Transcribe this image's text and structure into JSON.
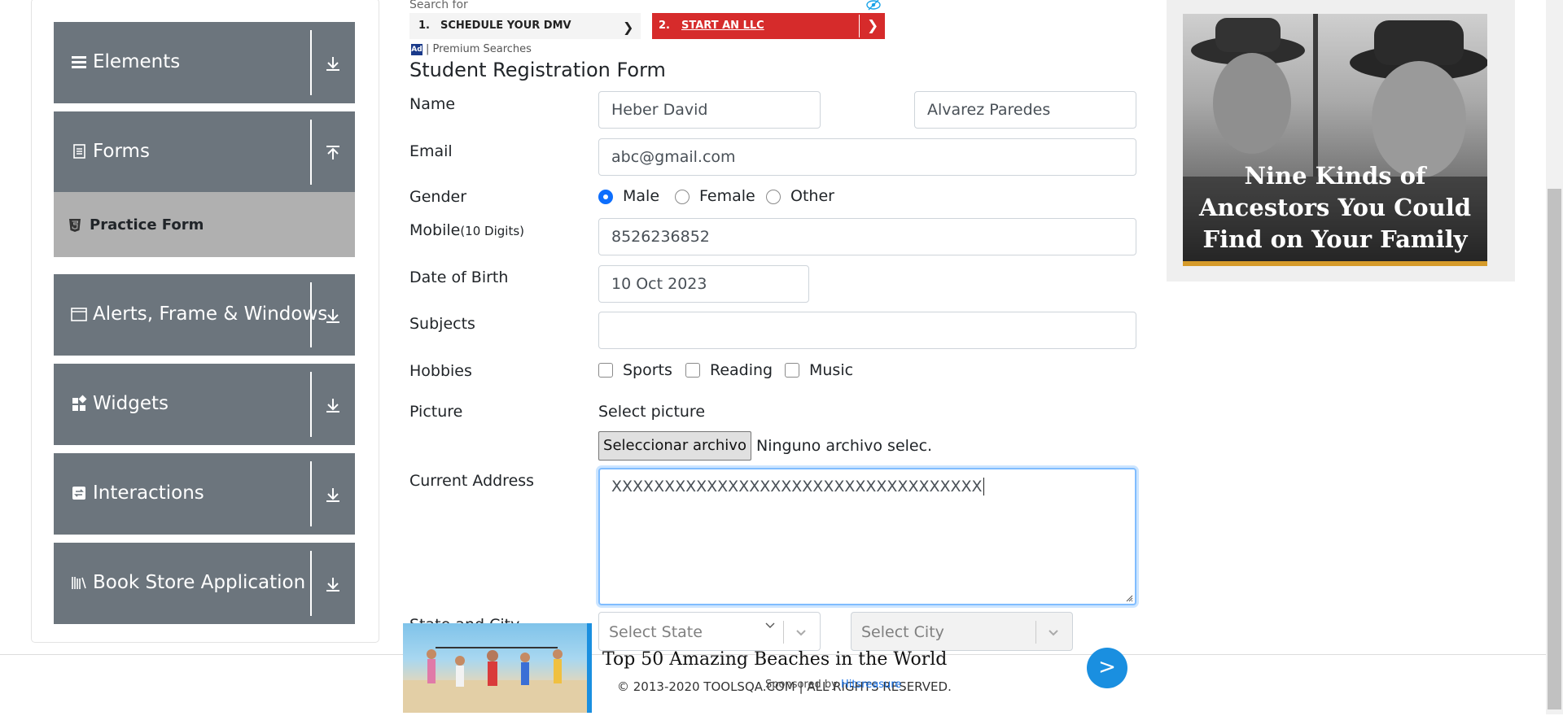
{
  "sidebar": {
    "groups": [
      {
        "label": "Elements",
        "icon": "menu-icon",
        "expanded": false
      },
      {
        "label": "Forms",
        "icon": "document-icon",
        "expanded": true
      },
      {
        "label": "Alerts, Frame & Windows",
        "icon": "window-icon",
        "expanded": false
      },
      {
        "label": "Widgets",
        "icon": "widgets-icon",
        "expanded": false
      },
      {
        "label": "Interactions",
        "icon": "interactions-icon",
        "expanded": false
      },
      {
        "label": "Book Store Application",
        "icon": "books-icon",
        "expanded": false
      }
    ],
    "active_item": {
      "label": "Practice Form",
      "icon": "html5-icon"
    }
  },
  "ad_top": {
    "search_for": "Search for",
    "items": [
      {
        "num": "1.",
        "text": "SCHEDULE YOUR DMV"
      },
      {
        "num": "2.",
        "text": "START AN LLC"
      }
    ],
    "badge": "Ad",
    "premium": "| Premium Searches"
  },
  "form": {
    "title": "Student Registration Form",
    "name_label": "Name",
    "first_name": "Heber David",
    "last_name": "Alvarez Paredes",
    "email_label": "Email",
    "email": "abc@gmail.com",
    "gender_label": "Gender",
    "gender_options": [
      "Male",
      "Female",
      "Other"
    ],
    "gender_selected": "Male",
    "mobile_label": "Mobile",
    "mobile_hint": "(10 Digits)",
    "mobile": "8526236852",
    "dob_label": "Date of Birth",
    "dob": "10 Oct 2023",
    "subjects_label": "Subjects",
    "subjects": "",
    "hobbies_label": "Hobbies",
    "hobbies": [
      "Sports",
      "Reading",
      "Music"
    ],
    "picture_label": "Picture",
    "picture_caption": "Select picture",
    "file_button": "Seleccionar archivo",
    "file_status": "Ninguno archivo selec.",
    "address_label": "Current Address",
    "address": "XXXXXXXXXXXXXXXXXXXXXXXXXXXXXXXXXXX",
    "state_city_label": "State and City",
    "state_placeholder": "Select State",
    "city_placeholder": "Select City"
  },
  "ad_right": {
    "caption": "Nine Kinds of Ancestors You Could Find on Your Family Tree"
  },
  "ad_bottom": {
    "headline": "Top 50 Amazing Beaches in the World",
    "sponsored": "Sponsored by",
    "sponsor": "Hitsreasure",
    "button": ">"
  },
  "footer": {
    "text": "© 2013-2020 TOOLSQA.COM | ALL RIGHTS RESERVED."
  },
  "colors": {
    "sidebar_group": "#6c757d",
    "sidebar_active": "#b0b0b0",
    "radio_checked": "#0d6efd",
    "ad_red": "#d62b2b",
    "ad_blue": "#1a8fe0",
    "focus_border": "#80bdff"
  }
}
